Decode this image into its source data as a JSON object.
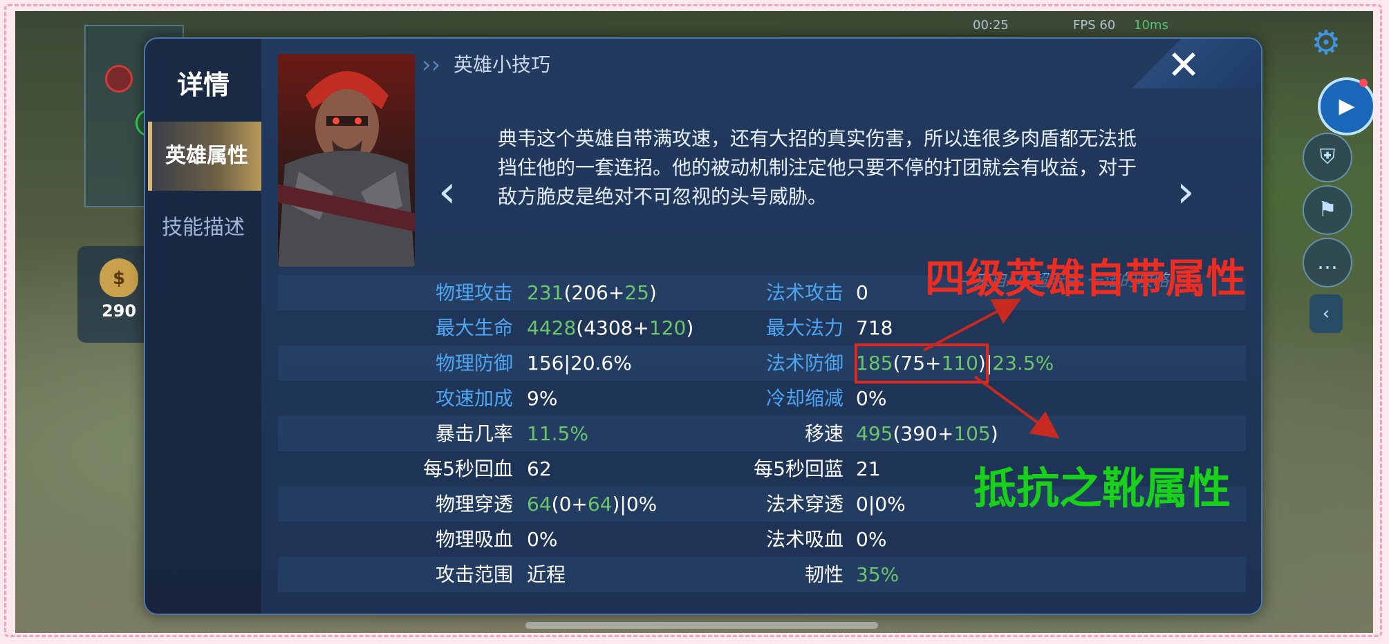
{
  "status": {
    "time": "00:25",
    "fps": "FPS 60",
    "ping": "10ms"
  },
  "gold": {
    "value": "290"
  },
  "sidebar": {
    "title": "详情",
    "tabs": [
      {
        "label": "英雄属性",
        "active": true
      },
      {
        "label": "技能描述",
        "active": false
      }
    ]
  },
  "tips": {
    "title": "英雄小技巧",
    "text": "典韦这个英雄自带满攻速，还有大招的真实伤害，所以连很多肉盾都无法抵挡住他的一套连招。他的被动机制注定他只要不停的打团就会有收益，对于敌方脆皮是绝对不可忽视的头号威胁。",
    "source_prefix": "—来自",
    "source_author": "AG超玩会.一诺",
    "source_suffix": "的攻略"
  },
  "stats": [
    {
      "l1": "物理攻击",
      "b1": true,
      "v1": [
        [
          "231",
          "g"
        ],
        [
          "(206+",
          ""
        ],
        [
          "25",
          "g"
        ],
        [
          ")",
          ""
        ]
      ],
      "l2": "法术攻击",
      "b2": true,
      "v2": [
        [
          "0",
          ""
        ]
      ]
    },
    {
      "l1": "最大生命",
      "b1": true,
      "v1": [
        [
          "4428",
          "g"
        ],
        [
          "(4308+",
          ""
        ],
        [
          "120",
          "g"
        ],
        [
          ")",
          ""
        ]
      ],
      "l2": "最大法力",
      "b2": true,
      "v2": [
        [
          "718",
          ""
        ]
      ]
    },
    {
      "l1": "物理防御",
      "b1": true,
      "v1": [
        [
          "156|20.6%",
          ""
        ]
      ],
      "l2": "法术防御",
      "b2": true,
      "v2": [
        [
          "185",
          "g"
        ],
        [
          "(75+",
          ""
        ],
        [
          "110",
          "g"
        ],
        [
          ")|",
          ""
        ],
        [
          "23.5%",
          "g"
        ]
      ]
    },
    {
      "l1": "攻速加成",
      "b1": true,
      "v1": [
        [
          "9%",
          ""
        ]
      ],
      "l2": "冷却缩减",
      "b2": true,
      "v2": [
        [
          "0%",
          ""
        ]
      ]
    },
    {
      "l1": "暴击几率",
      "b1": false,
      "v1": [
        [
          "11.5%",
          "g"
        ]
      ],
      "l2": "移速",
      "b2": false,
      "v2": [
        [
          "495",
          "g"
        ],
        [
          "(390+",
          ""
        ],
        [
          "105",
          "g"
        ],
        [
          ")",
          ""
        ]
      ]
    },
    {
      "l1": "每5秒回血",
      "b1": false,
      "v1": [
        [
          "62",
          ""
        ]
      ],
      "l2": "每5秒回蓝",
      "b2": false,
      "v2": [
        [
          "21",
          ""
        ]
      ]
    },
    {
      "l1": "物理穿透",
      "b1": false,
      "v1": [
        [
          "64",
          "g"
        ],
        [
          "(0+",
          ""
        ],
        [
          "64",
          "g"
        ],
        [
          ")|0%",
          ""
        ]
      ],
      "l2": "法术穿透",
      "b2": false,
      "v2": [
        [
          "0|0%",
          ""
        ]
      ]
    },
    {
      "l1": "物理吸血",
      "b1": false,
      "v1": [
        [
          "0%",
          ""
        ]
      ],
      "l2": "法术吸血",
      "b2": false,
      "v2": [
        [
          "0%",
          ""
        ]
      ]
    },
    {
      "l1": "攻击范围",
      "b1": false,
      "v1": [
        [
          "近程",
          ""
        ]
      ],
      "l2": "韧性",
      "b2": false,
      "v2": [
        [
          "35%",
          "g"
        ]
      ]
    }
  ],
  "annotations": {
    "red_label": "四级英雄自带属性",
    "green_label": "抵抗之靴属性"
  },
  "icons": {
    "close": "close-icon",
    "prev": "chevron-left-icon",
    "next": "chevron-right-icon",
    "settings": "gear-icon",
    "record": "video-camera-icon"
  },
  "colors": {
    "green_value": "#6cc56a",
    "blue_label": "#4ea5f2",
    "annotation_red": "#ee2d22",
    "annotation_green": "#19d11a"
  }
}
